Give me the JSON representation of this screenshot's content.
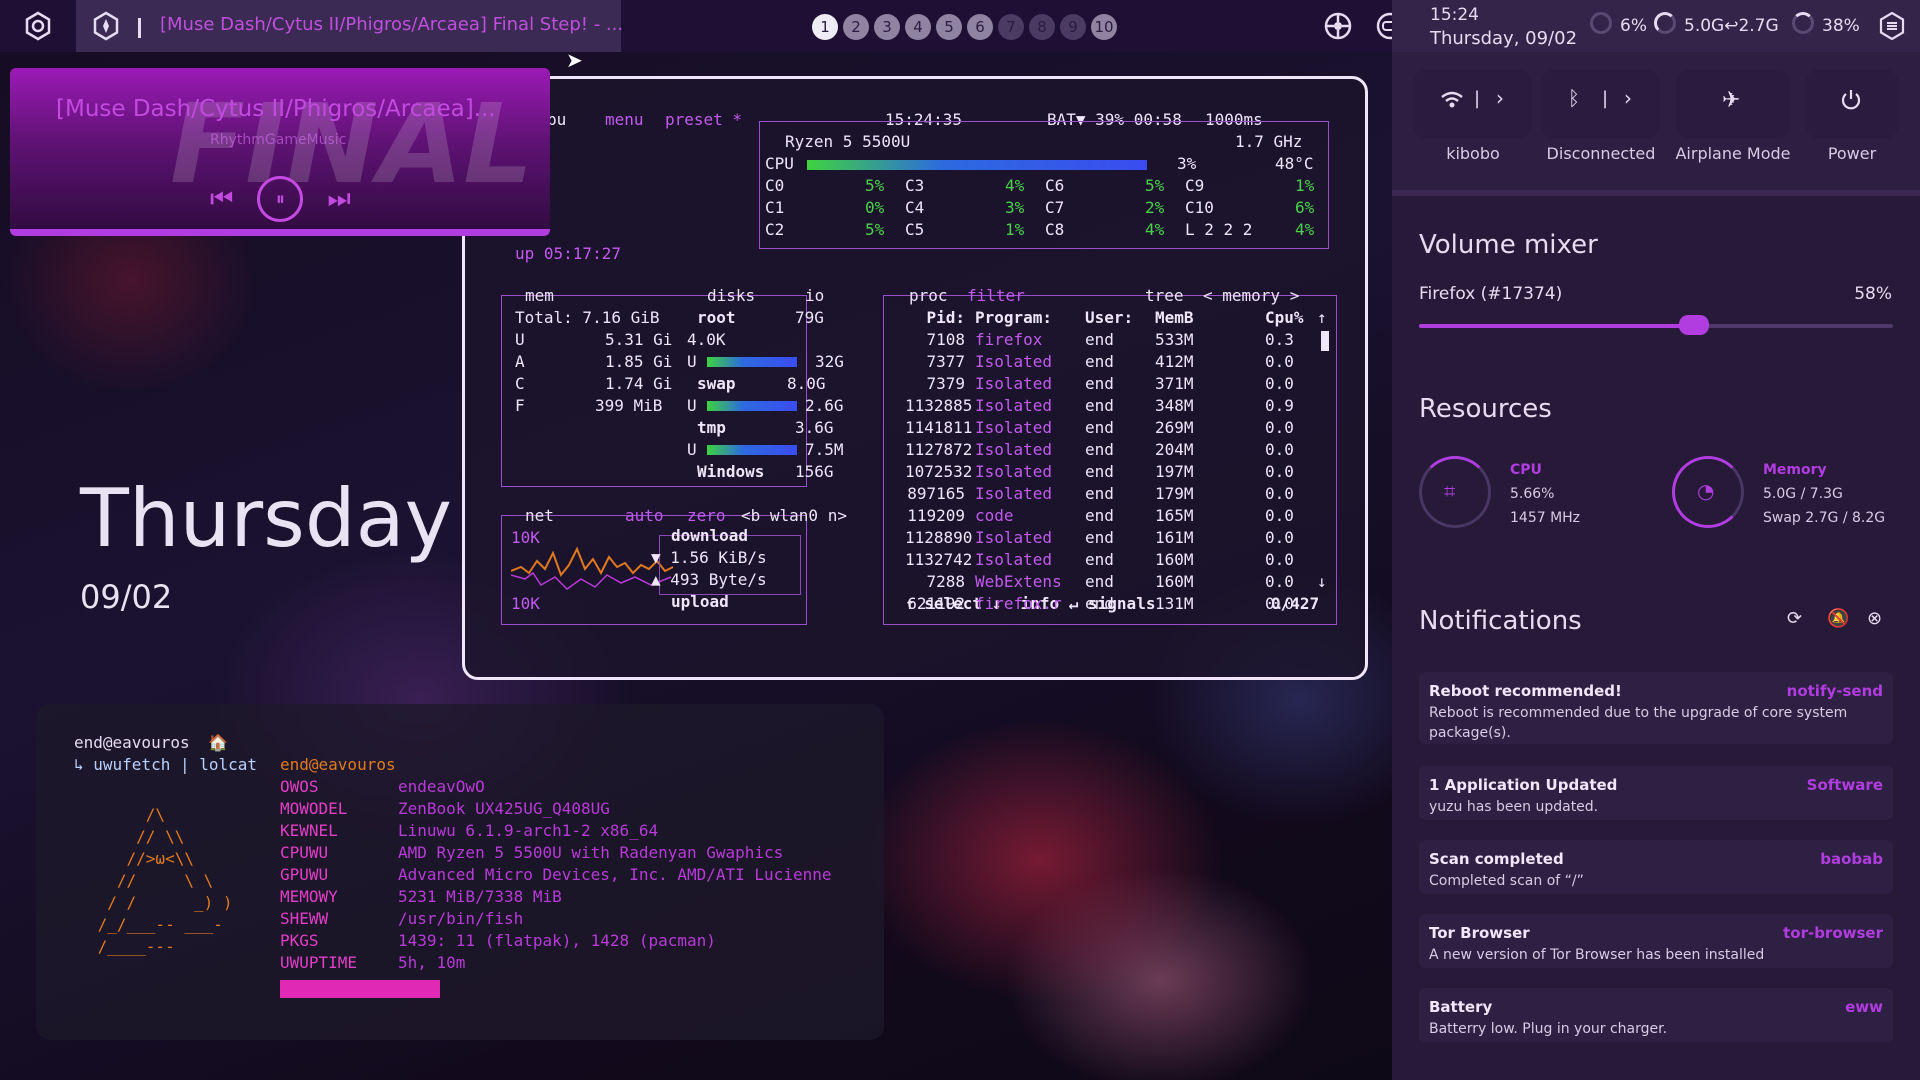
{
  "topbar": {
    "launcher_icon": "gear-hexagon-icon",
    "active_window_icon": "compass-icon",
    "active_window_title": "[Muse Dash/Cytus II/Phigros/Arcaea] Final Step! - ...",
    "workspaces": [
      "1",
      "2",
      "3",
      "4",
      "5",
      "6",
      "7",
      "8",
      "9",
      "10"
    ],
    "active_workspace": "1",
    "tray_icons": [
      "settings-wheel-icon",
      "gamepad-icon"
    ]
  },
  "header": {
    "time": "15:24",
    "date": "Thursday, 09/02",
    "cpu": "6%",
    "mem": "5.0G↩2.7G",
    "battery": "38%",
    "panel_icon": "sidebar-toggle-icon"
  },
  "quick": {
    "wifi_label": "kibobo",
    "bt_label": "Disconnected",
    "airplane_label": "Airplane Mode",
    "power_label": "Power"
  },
  "volume": {
    "title": "Volume mixer",
    "app": "Firefox (#17374)",
    "value": "58%",
    "level": 0.58
  },
  "resources": {
    "title": "Resources",
    "cpu_title": "CPU",
    "cpu_usage": "5.66%",
    "cpu_freq": "1457 MHz",
    "mem_title": "Memory",
    "mem_usage": "5.0G / 7.3G",
    "mem_swap": "Swap 2.7G / 8.2G"
  },
  "notifications": {
    "title": "Notifications",
    "items": [
      {
        "title": "Reboot recommended!",
        "app": "notify-send",
        "body": "Reboot is recommended due to the upgrade of core system package(s)."
      },
      {
        "title": "1 Application Updated",
        "app": "Software",
        "body": "yuzu has been updated."
      },
      {
        "title": "Scan completed",
        "app": "baobab",
        "body": "Completed scan of “/”"
      },
      {
        "title": "Tor Browser",
        "app": "tor-browser",
        "body": "A new version of Tor Browser has been installed"
      },
      {
        "title": "Battery",
        "app": "eww",
        "body": "Batterry low. Plug in your charger."
      }
    ]
  },
  "player": {
    "title": "[Muse Dash/Cytus II/Phigros/Arcaea]...",
    "art_text": "FINAL",
    "subtitle": "RhythmGameMusic",
    "progress": 1.0
  },
  "clock_widget": {
    "day": "Thursday",
    "date": "09/02"
  },
  "btop": {
    "header": {
      "cpu": "pu",
      "menu": "menu",
      "preset": "preset *",
      "time": "15:24:35",
      "bat": "BAT▼ 39% 00:58",
      "rate": "1000ms"
    },
    "cpu_model": "Ryzen 5 5500U",
    "freq": "1.7 GHz",
    "cpu_total": {
      "label": "CPU",
      "pct": "3%",
      "temp": "48°C"
    },
    "cores": [
      [
        "C0",
        "5%",
        "C3",
        "4%",
        "C6",
        "5%",
        "C9",
        "1%"
      ],
      [
        "C1",
        "0%",
        "C4",
        "3%",
        "C7",
        "2%",
        "C10",
        "6%"
      ],
      [
        "C2",
        "5%",
        "C5",
        "1%",
        "C8",
        "4%",
        "L 2 2 2",
        "4%"
      ]
    ],
    "uptime": "up 05:17:27",
    "mem": {
      "title": "mem",
      "total": "Total: 7.16 GiB",
      "rows": [
        [
          "U",
          "5.31 Gi"
        ],
        [
          "A",
          "1.85 Gi"
        ],
        [
          "C",
          "1.74 Gi"
        ],
        [
          "F",
          "399 MiB"
        ]
      ]
    },
    "disks": {
      "title": "disks",
      "io": "io",
      "rows": [
        [
          "root",
          "79G"
        ],
        [
          "4.0K",
          "",
          ""
        ],
        [
          "U",
          "32G"
        ],
        [
          "swap",
          "8.0G"
        ],
        [
          "U",
          "2.6G"
        ],
        [
          "tmp",
          "3.6G"
        ],
        [
          "U",
          "7.5M"
        ],
        [
          "Windows",
          "156G"
        ]
      ]
    },
    "net": {
      "title": "net",
      "mode": "auto",
      "zero": "zero",
      "iface": "<b wlan0 n>",
      "top": "10K",
      "bottom": "10K",
      "download": "download",
      "dl": "▼ 1.56 KiB/s",
      "ul": "▲ 493 Byte/s",
      "upload": "upload"
    },
    "proc": {
      "title": "proc",
      "filter": "filter",
      "tree": "tree",
      "sort": "< memory >",
      "header": [
        "Pid:",
        "Program:",
        "User:",
        "MemB",
        "Cpu%"
      ],
      "rows": [
        [
          "7108",
          "firefox",
          "end",
          "533M",
          "0.3"
        ],
        [
          "7377",
          "Isolated",
          "end",
          "412M",
          "0.0"
        ],
        [
          "7379",
          "Isolated",
          "end",
          "371M",
          "0.0"
        ],
        [
          "1132885",
          "Isolated",
          "end",
          "348M",
          "0.9"
        ],
        [
          "1141811",
          "Isolated",
          "end",
          "269M",
          "0.0"
        ],
        [
          "1127872",
          "Isolated",
          "end",
          "204M",
          "0.0"
        ],
        [
          "1072532",
          "Isolated",
          "end",
          "197M",
          "0.0"
        ],
        [
          "897165",
          "Isolated",
          "end",
          "179M",
          "0.0"
        ],
        [
          "119209",
          "code",
          "end",
          "165M",
          "0.0"
        ],
        [
          "1128890",
          "Isolated",
          "end",
          "161M",
          "0.0"
        ],
        [
          "1132742",
          "Isolated",
          "end",
          "160M",
          "0.0"
        ],
        [
          "7288",
          "WebExtens",
          "end",
          "160M",
          "0.0"
        ],
        [
          "621192",
          "firefox.r",
          "end",
          "131M",
          "0.0"
        ]
      ],
      "footer": "↑ select ↓  info ↵ signals",
      "count": "0/427"
    }
  },
  "terminal": {
    "prompt_user": "end@eavouros",
    "home_icon": "home-icon",
    "command": "↳ uwufetch | lolcat",
    "fetch_user": "end@eavouros",
    "ascii": "      /\\\n     // \\\\\n    //>ω<\\\\\n   //     \\ \\\n  / /      _) )\n /_/___-- ___-\n /____---",
    "fields": [
      [
        "OWOS",
        "endeavOwO"
      ],
      [
        "MOWODEL",
        "ZenBook UX425UG_Q408UG"
      ],
      [
        "KEWNEL",
        "Linuwu 6.1.9-arch1-2 x86_64"
      ],
      [
        "CPUWU",
        "AMD Ryzen 5 5500U with Radenyan Gwaphics"
      ],
      [
        "GPUWU",
        "Advanced Micro Devices, Inc. AMD/ATI Lucienne"
      ],
      [
        "MEMOWY",
        "5231 MiB/7338 MiB"
      ],
      [
        "SHEWW",
        "/usr/bin/fish"
      ],
      [
        "PKGS",
        "1439: 11 (flatpak), 1428 (pacman)"
      ],
      [
        "UWUPTIME",
        "5h, 10m"
      ]
    ]
  }
}
